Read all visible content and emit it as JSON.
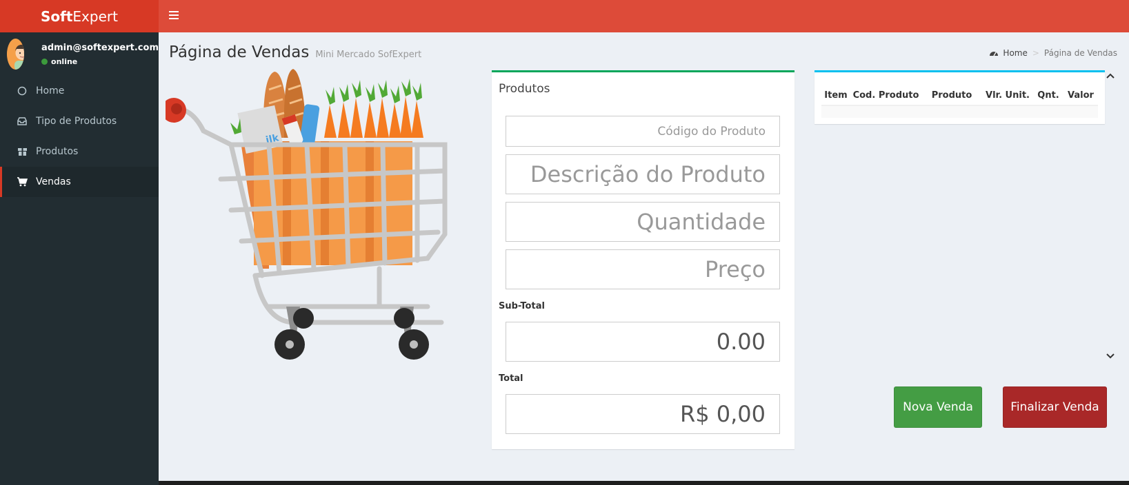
{
  "app": {
    "logo_bold": "Soft",
    "logo_light": "Expert"
  },
  "user": {
    "email": "admin@softexpert.com",
    "status": "online"
  },
  "sidebar": {
    "items": [
      {
        "label": "Home",
        "icon": "circle-icon"
      },
      {
        "label": "Tipo de Produtos",
        "icon": "inbox-icon"
      },
      {
        "label": "Produtos",
        "icon": "gift-icon"
      },
      {
        "label": "Vendas",
        "icon": "cart-icon",
        "active": true
      }
    ]
  },
  "header": {
    "title": "Página de Vendas",
    "subtitle": "Mini Mercado SofExpert"
  },
  "breadcrumb": {
    "home": "Home",
    "current": "Página de Vendas"
  },
  "produtos": {
    "title": "Produtos",
    "codigo_placeholder": "Código do Produto",
    "descricao_placeholder": "Descrição do Produto",
    "quantidade_placeholder": "Quantidade",
    "preco_placeholder": "Preço",
    "subtotal_label": "Sub-Total",
    "subtotal_value": "0.00",
    "total_label": "Total",
    "total_value": "R$ 0,00"
  },
  "table": {
    "columns": [
      "Item",
      "Cod. Produto",
      "Produto",
      "Vlr. Unit.",
      "Qnt.",
      "Valor"
    ]
  },
  "buttons": {
    "nova_venda": "Nova Venda",
    "finalizar_venda": "Finalizar Venda"
  },
  "colors": {
    "header": "#dd4b39",
    "logo_bg": "#d73925",
    "sidebar": "#222d32",
    "success": "#449d44",
    "danger": "#a92828",
    "box_green": "#00a65a",
    "box_blue": "#00c0ef"
  }
}
